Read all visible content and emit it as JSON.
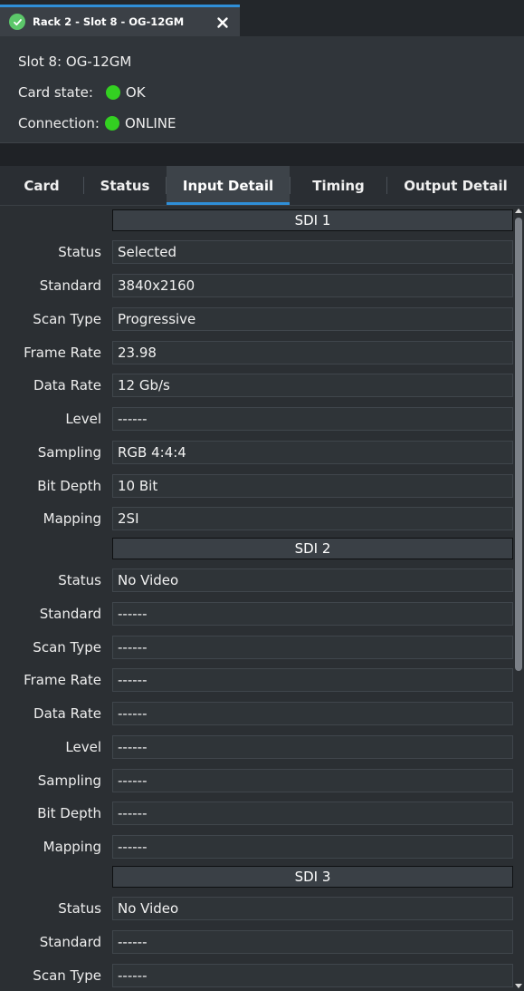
{
  "window": {
    "tab_title": "Rack 2 - Slot 8 - OG-12GM"
  },
  "info": {
    "slot": "Slot 8: OG-12GM",
    "card_state_label": "Card state:",
    "card_state_value": "OK",
    "connection_label": "Connection:",
    "connection_value": "ONLINE",
    "status_color": "#33d021"
  },
  "tabs": [
    {
      "label": "Card",
      "active": false
    },
    {
      "label": "Status",
      "active": false
    },
    {
      "label": "Input Detail",
      "active": true
    },
    {
      "label": "Timing",
      "active": false
    },
    {
      "label": "Output Detail",
      "active": false
    }
  ],
  "sections": [
    {
      "header": "SDI 1",
      "rows": [
        {
          "label": "Status",
          "value": "Selected"
        },
        {
          "label": "Standard",
          "value": "3840x2160"
        },
        {
          "label": "Scan Type",
          "value": "Progressive"
        },
        {
          "label": "Frame Rate",
          "value": "23.98"
        },
        {
          "label": "Data Rate",
          "value": "12 Gb/s"
        },
        {
          "label": "Level",
          "value": "------"
        },
        {
          "label": "Sampling",
          "value": "RGB 4:4:4"
        },
        {
          "label": "Bit Depth",
          "value": "10 Bit"
        },
        {
          "label": "Mapping",
          "value": "2SI"
        }
      ]
    },
    {
      "header": "SDI 2",
      "rows": [
        {
          "label": "Status",
          "value": "No Video"
        },
        {
          "label": "Standard",
          "value": "------"
        },
        {
          "label": "Scan Type",
          "value": "------"
        },
        {
          "label": "Frame Rate",
          "value": "------"
        },
        {
          "label": "Data Rate",
          "value": "------"
        },
        {
          "label": "Level",
          "value": "------"
        },
        {
          "label": "Sampling",
          "value": "------"
        },
        {
          "label": "Bit Depth",
          "value": "------"
        },
        {
          "label": "Mapping",
          "value": "------"
        }
      ]
    },
    {
      "header": "SDI 3",
      "rows": [
        {
          "label": "Status",
          "value": "No Video"
        },
        {
          "label": "Standard",
          "value": "------"
        },
        {
          "label": "Scan Type",
          "value": "------"
        }
      ]
    }
  ]
}
